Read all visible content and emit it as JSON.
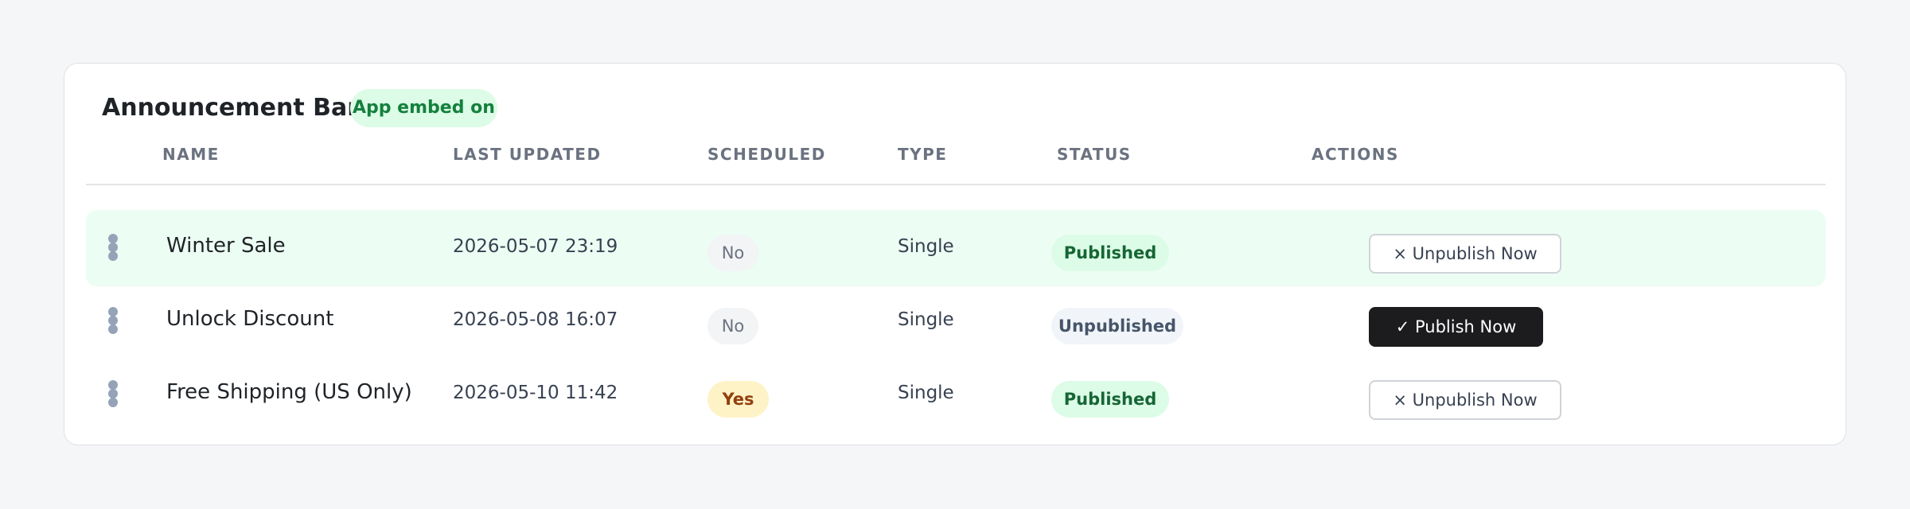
{
  "header": {
    "title": "Announcement Bar",
    "embed_badge": "App embed on"
  },
  "columns": [
    "NAME",
    "LAST UPDATED",
    "SCHEDULED",
    "TYPE",
    "STATUS",
    "ACTIONS"
  ],
  "rows": [
    {
      "name": "Winter Sale",
      "last_updated": "2026-05-07 23:19",
      "scheduled": "No",
      "type": "Single",
      "status": "Published",
      "action": "× Unpublish Now",
      "highlighted": true
    },
    {
      "name": "Unlock Discount",
      "last_updated": "2026-05-08 16:07",
      "scheduled": "No",
      "type": "Single",
      "status": "Unpublished",
      "action": "✓ Publish Now",
      "highlighted": false
    },
    {
      "name": "Free Shipping (US Only)",
      "last_updated": "2026-05-10 11:42",
      "scheduled": "Yes",
      "type": "Single",
      "status": "Published",
      "action": "× Unpublish Now",
      "highlighted": false
    }
  ],
  "icons": {
    "drag_handle": "drag-handle-icon"
  },
  "colors": {
    "published": "#166534",
    "published_bg": "#dcfce7",
    "unpublished": "#475569",
    "scheduled_yes": "#92400e",
    "scheduled_yes_bg": "#fef3c7",
    "highlight_row_bg": "#ecfdf3",
    "primary_button_bg": "#1c1c1e"
  }
}
